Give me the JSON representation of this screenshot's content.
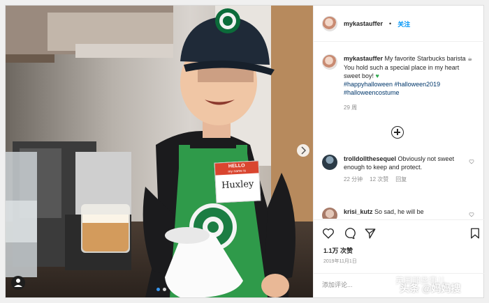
{
  "header": {
    "username": "mykastauffer",
    "dot": "•",
    "follow_label": "关注"
  },
  "caption": {
    "username": "mykastauffer",
    "text_a": "My favorite Starbucks barista",
    "text_b": "You hold such a special place in my heart sweet boy!",
    "hashtags_line1": "#happyhalloween #halloween2019",
    "hashtags_line2": "#halloweencostume",
    "time": "29 周"
  },
  "comments": [
    {
      "username": "trolldollthesequel",
      "text": "Obviously not sweet enough to keep and protect.",
      "time": "22 分钟",
      "likes": "12 次赞",
      "reply": "回复"
    },
    {
      "username": "krisi_kutz",
      "text": "So sad, he will be"
    }
  ],
  "actions": {
    "likes": "1.1万 次赞",
    "date": "2019年11月1日",
    "comment_placeholder": "添加评论..."
  },
  "photo": {
    "badge_text": "HELLO",
    "badge_sub": "my name is",
    "badge_name": "Huxley"
  },
  "watermark": {
    "line1": "英国那些事儿",
    "line2": "头条 @妈妈搜"
  },
  "colors": {
    "apron": "#2f9a4a",
    "link": "#0095f6",
    "hashtag": "#00376b"
  }
}
